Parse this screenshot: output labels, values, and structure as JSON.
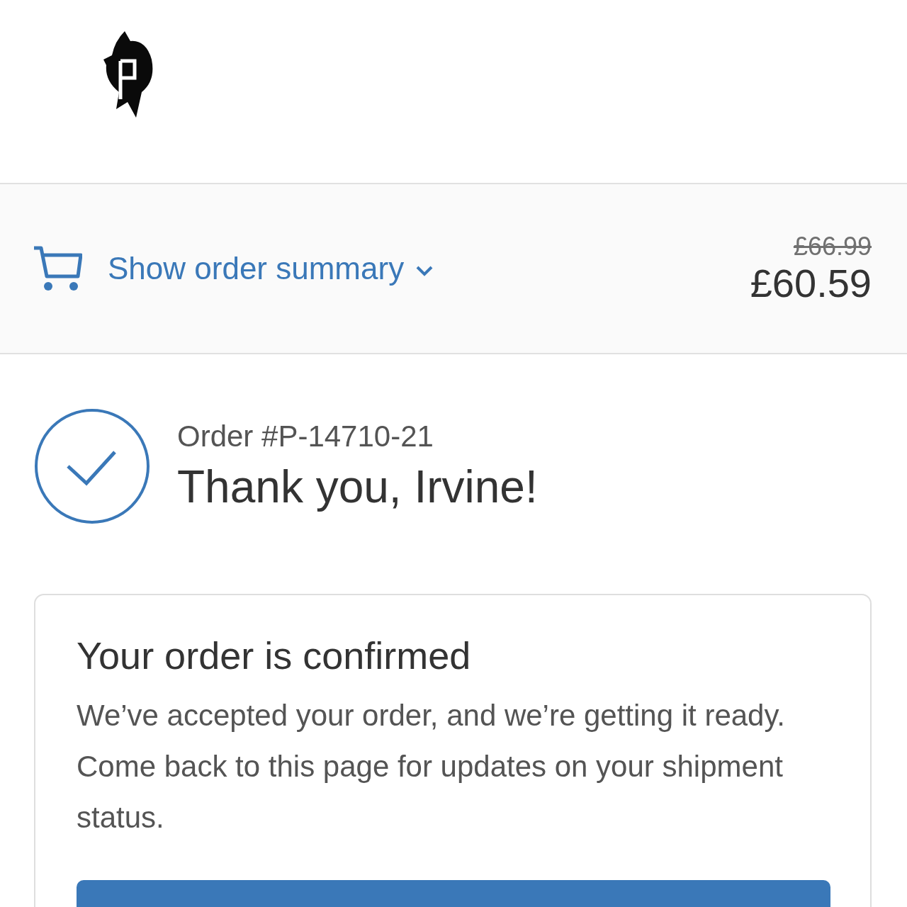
{
  "summary_bar": {
    "label": "Show order summary",
    "expanded": false,
    "original_price": "£66.99",
    "total": "£60.59"
  },
  "order": {
    "number": "Order #P-14710-21",
    "greeting": "Thank you, Irvine!"
  },
  "confirmation_card": {
    "title": "Your order is confirmed",
    "message": "We’ve accepted your order, and we’re getting it ready. Come back to this page for updates on your shipment status."
  }
}
